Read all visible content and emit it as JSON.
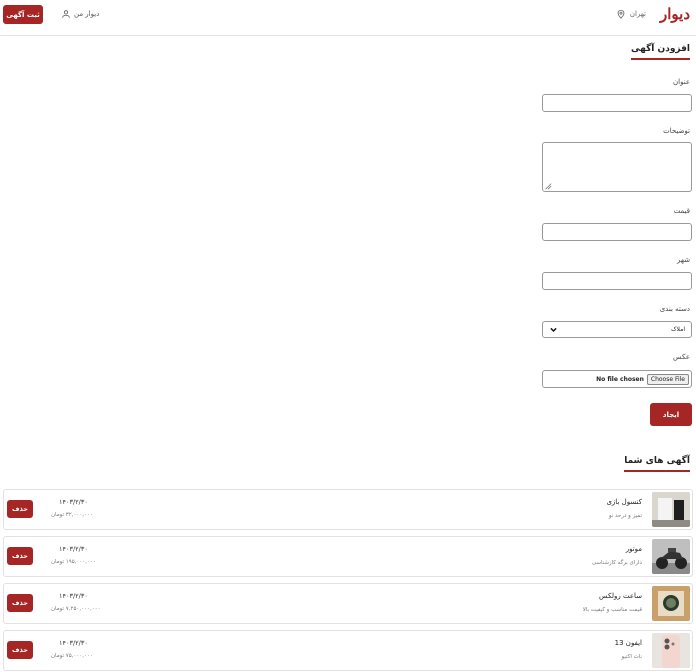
{
  "header": {
    "logo": "دیوار",
    "city": "تهران",
    "my_divar": "دیوار من",
    "post_ad": "ثبت آگهی"
  },
  "form": {
    "title": "افزودن آگهی",
    "labels": {
      "title": "عنوان",
      "description": "توضیحات",
      "price": "قیمت",
      "city": "شهر",
      "category": "دسته بندی",
      "photo": "عکس"
    },
    "values": {
      "title": "",
      "description": "",
      "price": "",
      "city": ""
    },
    "category_selected": "املاک",
    "file_button": "Choose File",
    "file_status": "No file chosen",
    "submit": "ایجاد"
  },
  "ads_section": {
    "title": "آگهی های شما",
    "delete_label": "حذف",
    "items": [
      {
        "title": "کنسول بازی",
        "description": "تمیز و درحد نو",
        "date": "۱۴۰۳/۲/۳۰",
        "price": "۳۲,۰۰۰,۰۰۰ تومان"
      },
      {
        "title": "موتور",
        "description": "دارای برگه کارشناسی",
        "date": "۱۴۰۳/۲/۳۰",
        "price": "۱۹۵,۰۰۰,۰۰۰ تومان"
      },
      {
        "title": "ساعت رولکس",
        "description": "قیمت مناسب و کیفیت بالا",
        "date": "۱۴۰۳/۲/۳۰",
        "price": "۷,۲۵۰,۰۰۰,۰۰۰ تومان"
      },
      {
        "title": "ایفون 13",
        "description": "نات اکتیو",
        "date": "۱۴۰۳/۲/۳۰",
        "price": "۷۵,۰۰۰,۰۰۰ تومان"
      }
    ]
  },
  "colors": {
    "brand": "#a62626"
  }
}
